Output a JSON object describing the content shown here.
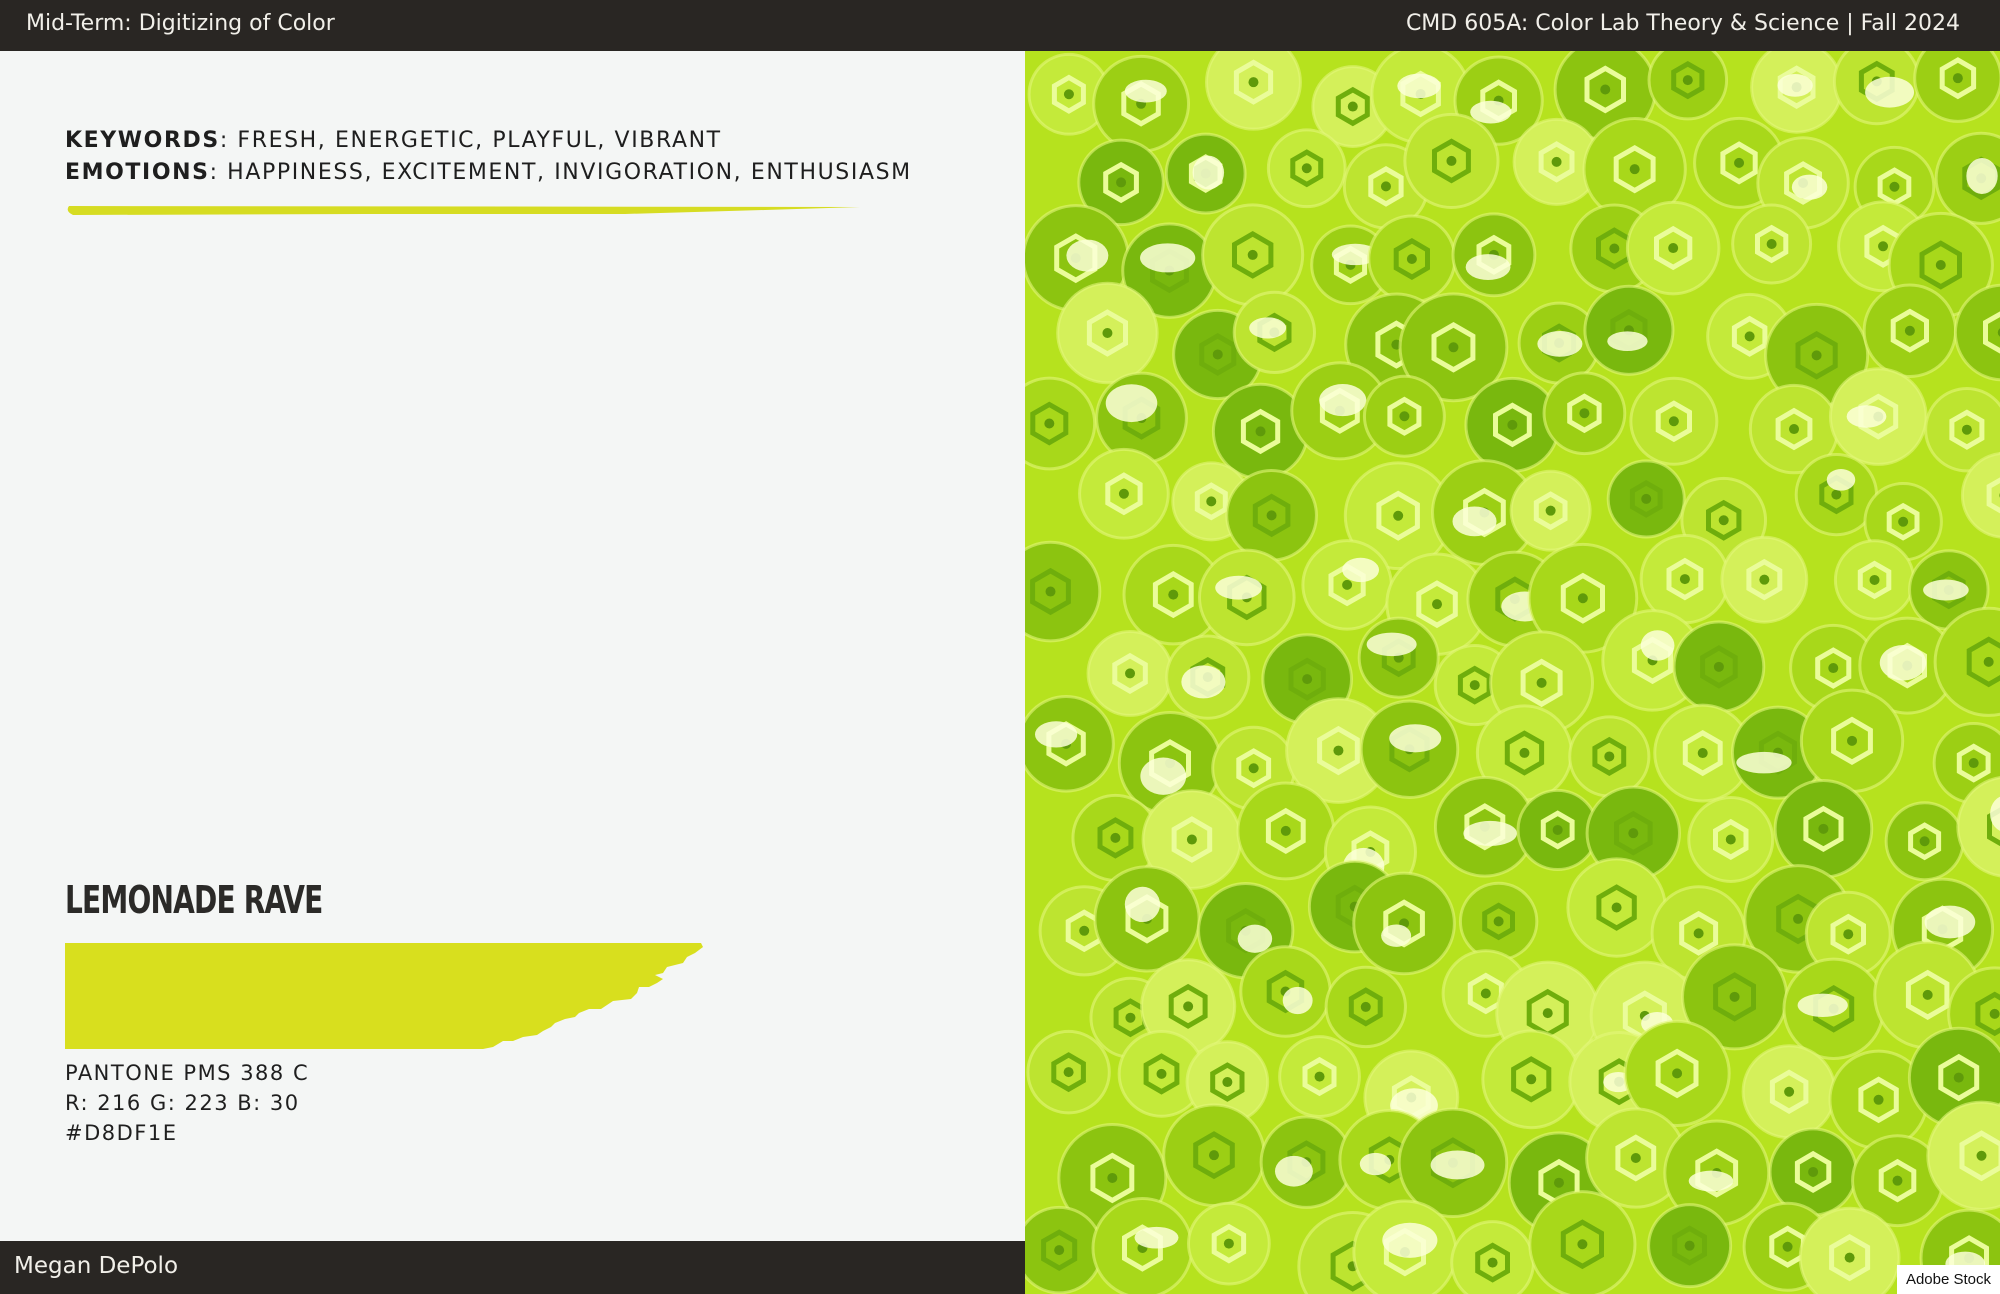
{
  "header": {
    "left_title": "Mid-Term: Digitizing of Color",
    "right_title": "CMD 605A: Color Lab Theory & Science | Fall 2024"
  },
  "keywords": {
    "label": "KEYWORDS",
    "value": ": FRESH, ENERGETIC, PLAYFUL, VIBRANT"
  },
  "emotions": {
    "label": "EMOTIONS",
    "value": ": HAPPINESS, EXCITEMENT, INVIGORATION, ENTHUSIASM"
  },
  "color": {
    "name": "LEMONADE RAVE",
    "pantone": "PANTONE PMS 388 C",
    "rgb": "R: 216 G: 223 B: 30",
    "hex": "#D8DF1E",
    "swatch_hex": "#D8DF1E"
  },
  "footer": {
    "author": "Megan DePolo"
  },
  "photo": {
    "credit": "Adobe Stock",
    "icon": "sequins-texture-image",
    "base_color": "#B6E21E"
  }
}
